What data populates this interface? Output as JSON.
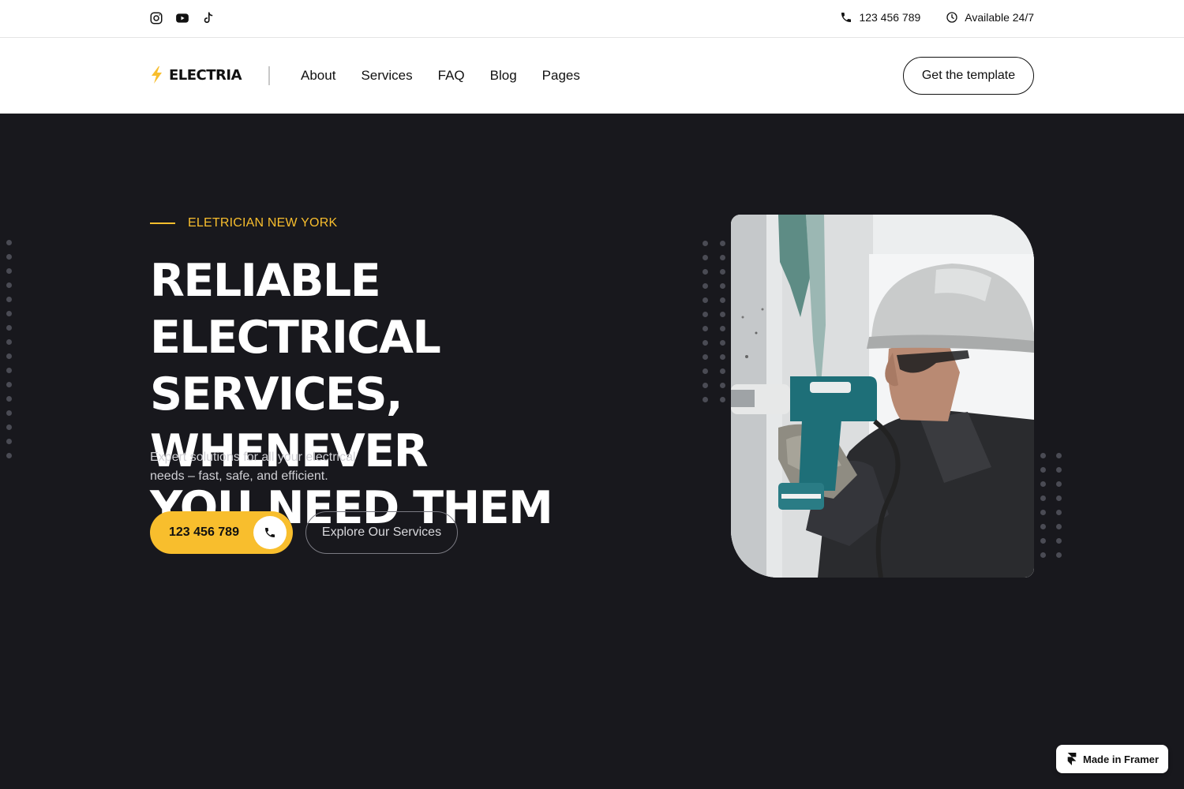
{
  "topbar": {
    "social": [
      {
        "name": "instagram-icon"
      },
      {
        "name": "youtube-icon"
      },
      {
        "name": "tiktok-icon"
      }
    ],
    "phone": "123 456 789",
    "availability": "Available 24/7"
  },
  "nav": {
    "brand": "ELECTRIA",
    "links": [
      "About",
      "Services",
      "FAQ",
      "Blog",
      "Pages"
    ],
    "cta": "Get the template"
  },
  "hero": {
    "eyebrow": "ELETRICIAN NEW YORK",
    "headline_lines": [
      "RELIABLE ELECTRICAL",
      "SERVICES, WHENEVER",
      "YOU NEED THEM"
    ],
    "subtext_lines": [
      "Expert solutions for all your electrical",
      "needs – fast, safe, and efficient."
    ],
    "phone_button": "123 456 789",
    "explore_button": "Explore Our Services"
  },
  "badge": {
    "label": "Made in Framer"
  },
  "colors": {
    "accent": "#f8be2d",
    "hero_bg": "#18181d",
    "white": "#ffffff"
  }
}
